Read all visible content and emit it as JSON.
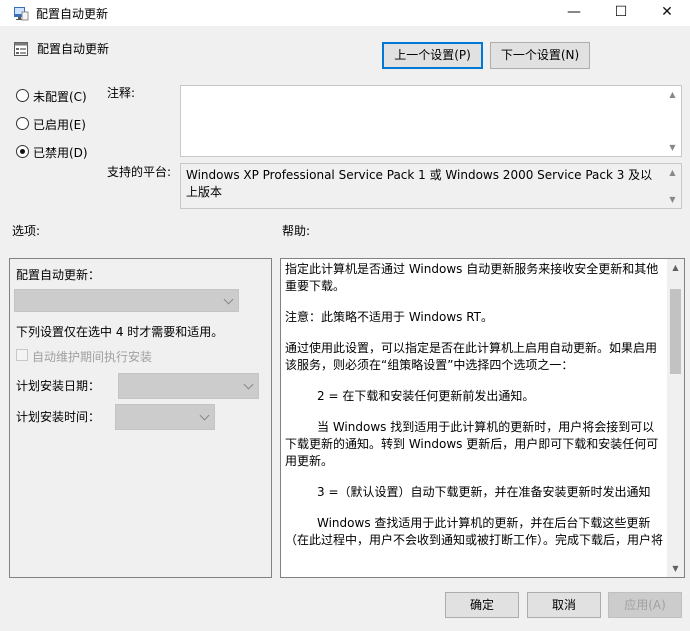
{
  "window": {
    "title": "配置自动更新",
    "minimize_glyph": "—",
    "maximize_glyph": "☐",
    "close_glyph": "✕"
  },
  "header": {
    "policy_title": "配置自动更新",
    "prev_button": "上一个设置(P)",
    "next_button": "下一个设置(N)"
  },
  "state": {
    "options": [
      {
        "label": "未配置(C)",
        "checked": false
      },
      {
        "label": "已启用(E)",
        "checked": false
      },
      {
        "label": "已禁用(D)",
        "checked": true
      }
    ]
  },
  "note": {
    "label": "注释:",
    "value": ""
  },
  "platform": {
    "label": "支持的平台:",
    "value": "Windows XP Professional Service Pack 1 或 Windows 2000 Service Pack 3 及以上版本"
  },
  "options_panel": {
    "section_label": "选项:",
    "title": "配置自动更新：",
    "main_select_value": "",
    "note": "下列设置仅在选中 4 时才需要和适用。",
    "checkbox_label": "自动维护期间执行安装",
    "day_label": "计划安装日期：",
    "day_value": "",
    "time_label": "计划安装时间：",
    "time_value": ""
  },
  "help_panel": {
    "section_label": "帮助:",
    "paragraphs": [
      "指定此计算机是否通过 Windows 自动更新服务来接收安全更新和其他重要下载。",
      "注意：此策略不适用于 Windows RT。",
      "通过使用此设置，可以指定是否在此计算机上启用自动更新。如果启用该服务，则必须在“组策略设置”中选择四个选项之一：",
      "2 = 在下载和安装任何更新前发出通知。",
      "当 Windows 找到适用于此计算机的更新时，用户将会接到可以下载更新的通知。转到 Windows 更新后，用户即可下载和安装任何可用更新。",
      "3 =（默认设置）自动下载更新，并在准备安装更新时发出通知",
      "Windows 查找适用于此计算机的更新，并在后台下载这些更新（在此过程中，用户不会收到通知或被打断工作）。完成下载后，用户将"
    ]
  },
  "footer": {
    "ok_button": "确定",
    "cancel_button": "取消",
    "apply_button": "应用(A)"
  }
}
